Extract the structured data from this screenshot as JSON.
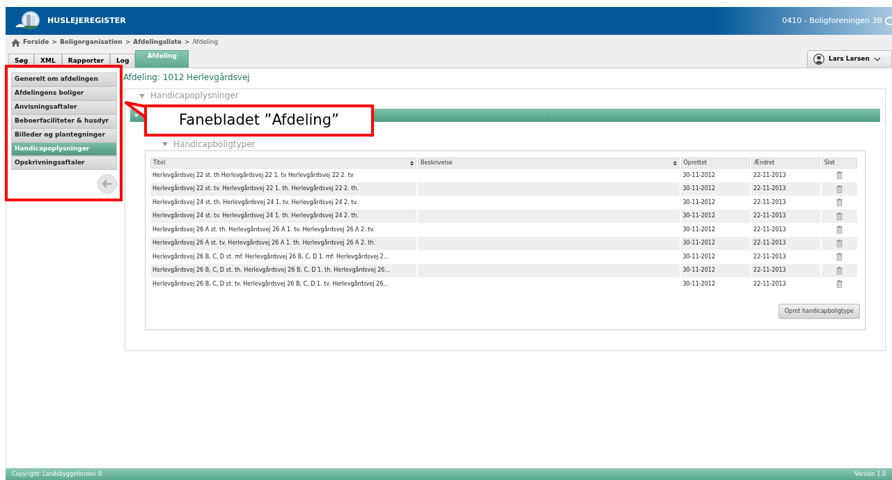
{
  "header": {
    "logo_text": "HUSLEJEREGISTER",
    "organisation": "0410 - Boligforeningen 3B"
  },
  "breadcrumb": [
    "Forside",
    "Boligorganisation",
    "Afdelingsliste",
    "Afdeling"
  ],
  "breadcrumb_separator": ">",
  "tabs": [
    {
      "label": "Søg",
      "selected": false
    },
    {
      "label": "XML",
      "selected": false
    },
    {
      "label": "Rapporter",
      "selected": false
    },
    {
      "label": "Log",
      "selected": false
    },
    {
      "label": "Afdeling",
      "selected": true
    }
  ],
  "user": {
    "name": "Lars Larsen"
  },
  "sidebar": {
    "items": [
      {
        "label": "Generelt om afdelingen",
        "selected": false
      },
      {
        "label": "Afdelingens boliger",
        "selected": false
      },
      {
        "label": "Anvisningsaftaler",
        "selected": false
      },
      {
        "label": "Beboerfaciliteter & husdyr",
        "selected": false
      },
      {
        "label": "Billeder og plantegninger",
        "selected": false
      },
      {
        "label": "Handicapoplysninger",
        "selected": true
      },
      {
        "label": "Opskrivningsaftaler",
        "selected": false
      }
    ]
  },
  "page_title": "Afdeling: 1012 Herlevgårdsvej",
  "section_title": "Handicapoplysninger",
  "subsection_title": "Handicapboligtyper",
  "table": {
    "columns": [
      "Titel",
      "Beskrivelse",
      "Oprettet",
      "Ændret",
      "Slet"
    ],
    "rows": [
      {
        "titel": "Herlevgårdsvej 22 st. th Herlevgårdsvej 22 1. tv Herlevgårdsvej 22 2. tv",
        "oprettet": "30-11-2012",
        "aendret": "22-11-2013"
      },
      {
        "titel": "Herlevgårdsvej 22 st. tv. Herlevgårdsvej 22 1. th. Herlevgårdsvej 22 2. th.",
        "oprettet": "30-11-2012",
        "aendret": "22-11-2013"
      },
      {
        "titel": "Herlevgårdsvej 24 st. th. Herlevgårdsvej 24 1. tv. Herlevgårdsvej 24 2. tv.",
        "oprettet": "30-11-2012",
        "aendret": "22-11-2013"
      },
      {
        "titel": "Herlevgårdsvej 24 st. tv. Herlevgårdsvej 24 1. th. Herlevgårdsvej 24 2. th.",
        "oprettet": "30-11-2012",
        "aendret": "22-11-2013"
      },
      {
        "titel": "Herlevgårdsvej 26 A st. th. Herlevgårdsvej 26 A 1. tv. Herlevgårdsvej 26 A 2. tv.",
        "oprettet": "30-11-2012",
        "aendret": "22-11-2013"
      },
      {
        "titel": "Herlevgårdsvej 26 A st. tv. Herlevgårdsvej 26 A 1. th. Herlevgårdsvej 26 A 2. th.",
        "oprettet": "30-11-2012",
        "aendret": "22-11-2013"
      },
      {
        "titel": "Herlevgårdsvej 26 B, C, D st. mf. Herlevgårdsvej 26 B, C, D 1. mf. Herlevgårdsvej 2...",
        "oprettet": "30-11-2012",
        "aendret": "22-11-2013"
      },
      {
        "titel": "Herlevgårdsvej 26 B, C, D st. th. Herlevgårdsvej 26 B, C, D 1. th. Herlevgårdsvej 26...",
        "oprettet": "30-11-2012",
        "aendret": "22-11-2013"
      },
      {
        "titel": "Herlevgårdsvej 26 B, C, D st. tv. Herlevgårdsvej 26 B, C, D 1. tv. Herlevgårdsvej 26...",
        "oprettet": "30-11-2012",
        "aendret": "22-11-2013"
      }
    ]
  },
  "create_button": "Opret handicapboligtype",
  "annotation": {
    "text": "Fanebladet ”Afdeling”"
  },
  "footer": {
    "copyright": "Copyright: Landsbyggefonden ©",
    "version": "Version 1.0"
  }
}
